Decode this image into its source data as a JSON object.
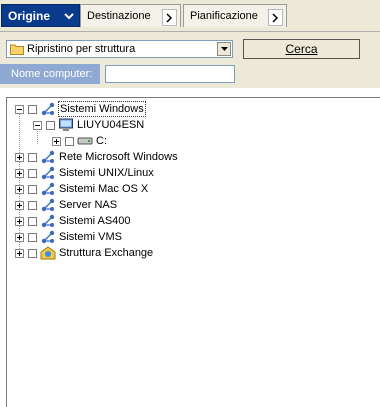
{
  "tabs": [
    {
      "label": "Origine"
    },
    {
      "label": "Destinazione"
    },
    {
      "label": "Pianificazione"
    }
  ],
  "view_select": {
    "value": "Ripristino per struttura"
  },
  "search": {
    "button_label": "Cerca",
    "computer_name_label": "Nome computer:",
    "computer_name_value": ""
  },
  "tree": {
    "root": "Sistemi Windows",
    "computer": "LIUYU04ESN",
    "drive": "C:",
    "nodes": [
      "Rete Microsoft Windows",
      "Sistemi UNIX/Linux",
      "Sistemi Mac OS X",
      "Server NAS",
      "Sistemi AS400",
      "Sistemi VMS",
      "Struttura Exchange"
    ]
  },
  "colors": {
    "active_tab": "#0a3a8c",
    "label_bg": "#8fa9d2",
    "chrome": "#ece9d8"
  }
}
